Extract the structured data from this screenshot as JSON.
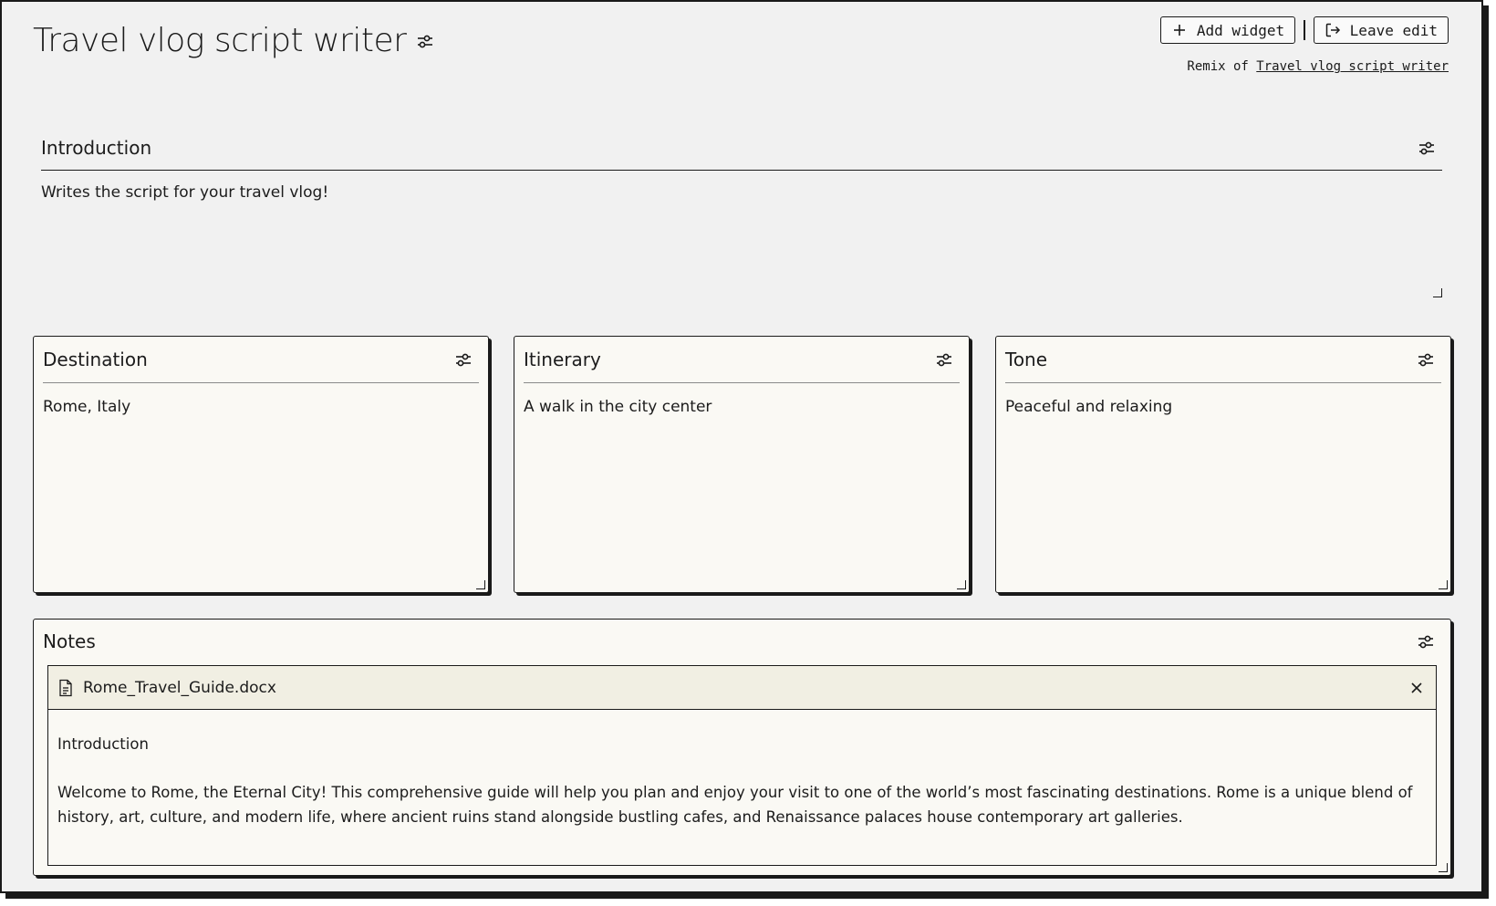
{
  "header": {
    "title": "Travel vlog script writer",
    "add_widget_label": "Add widget",
    "leave_edit_label": "Leave edit",
    "remix_prefix": "Remix of",
    "remix_link": "Travel vlog script writer"
  },
  "introduction": {
    "label": "Introduction",
    "text": "Writes the script for your travel vlog!"
  },
  "widgets": [
    {
      "label": "Destination",
      "value": "Rome, Italy"
    },
    {
      "label": "Itinerary",
      "value": "A walk in the city center"
    },
    {
      "label": "Tone",
      "value": "Peaceful and relaxing"
    }
  ],
  "notes": {
    "label": "Notes",
    "file_name": "Rome_Travel_Guide.docx",
    "content_heading": "Introduction",
    "content_paragraph": "Welcome to Rome, the Eternal City! This comprehensive guide will help you plan and enjoy your visit to one of the world’s most fascinating destinations. Rome is a unique blend of history, art, culture, and modern life, where ancient ruins stand alongside bustling cafes, and Renaissance palaces house contemporary art galleries."
  },
  "icons": {
    "settings": "sliders-icon",
    "add": "plus-icon",
    "leave": "logout-icon",
    "file": "document-icon",
    "close": "close-icon"
  },
  "colors": {
    "background": "#f1f1f1",
    "card": "#faf9f4",
    "file_bar": "#f1efe3",
    "border": "#1a1a1a"
  }
}
